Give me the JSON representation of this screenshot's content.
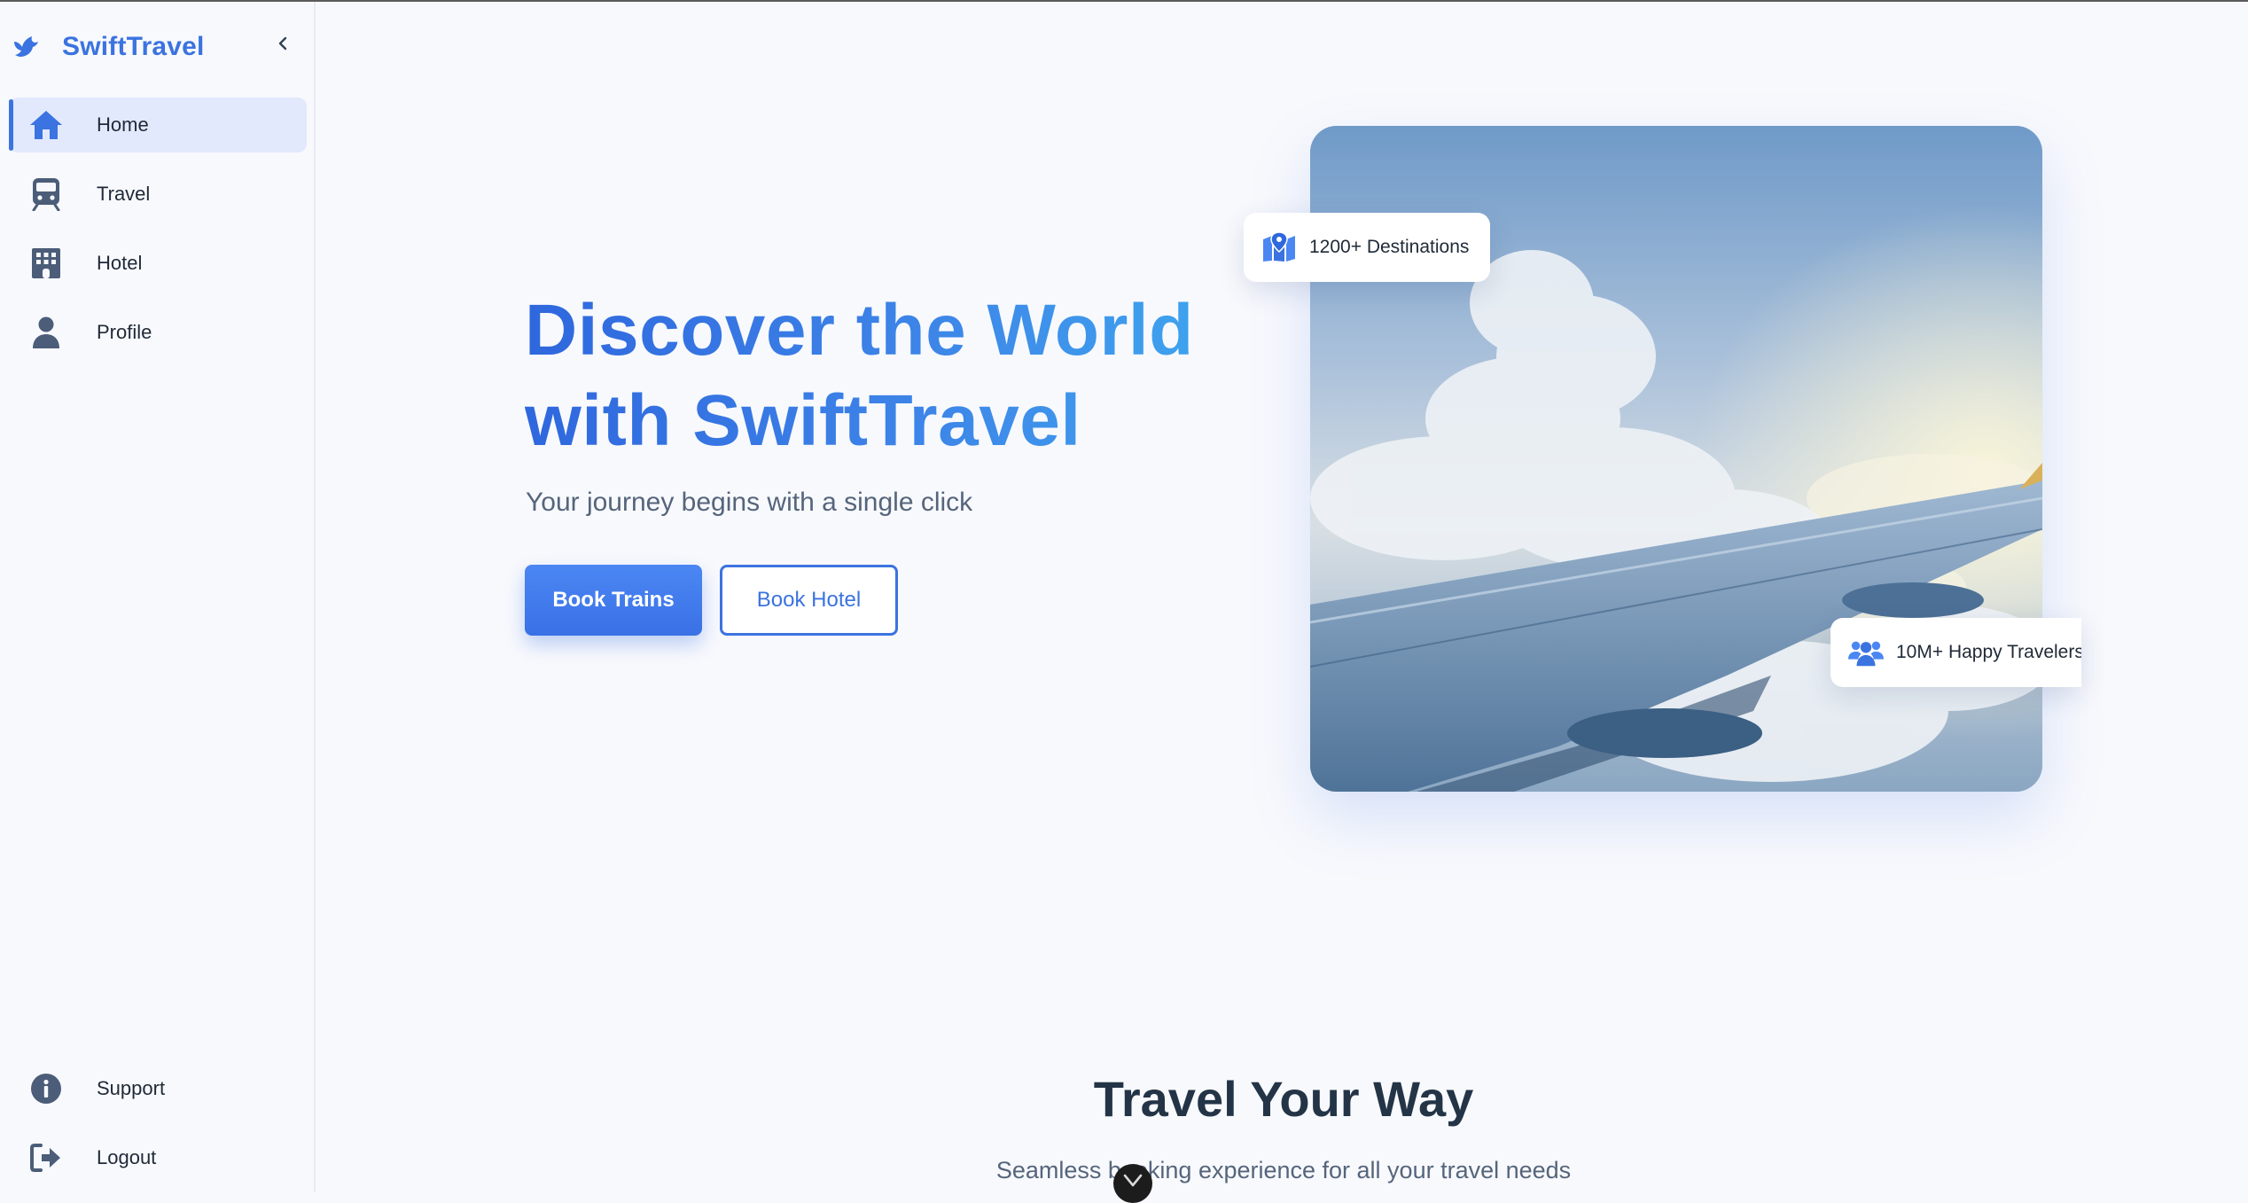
{
  "app": {
    "name": "SwiftTravel"
  },
  "sidebar": {
    "items": [
      {
        "label": "Home",
        "icon": "home-icon",
        "active": true
      },
      {
        "label": "Travel",
        "icon": "train-icon"
      },
      {
        "label": "Hotel",
        "icon": "building-icon"
      },
      {
        "label": "Profile",
        "icon": "user-icon"
      }
    ],
    "bottom_items": [
      {
        "label": "Support",
        "icon": "info-icon"
      },
      {
        "label": "Logout",
        "icon": "logout-icon"
      }
    ]
  },
  "hero": {
    "title_line1": "Discover the World",
    "title_line2": "with SwiftTravel",
    "subtitle": "Your journey begins with a single click",
    "primary_button": "Book Trains",
    "secondary_button": "Book Hotel"
  },
  "stats": {
    "destinations": "1200+ Destinations",
    "travelers": "10M+ Happy Travelers"
  },
  "section": {
    "title": "Travel Your Way",
    "subtitle": "Seamless booking experience for all your travel needs"
  },
  "colors": {
    "accent": "#3b73e0",
    "background": "#f8f9fd",
    "active_nav_bg": "#e2e9fc",
    "heading_dark": "#243447"
  }
}
